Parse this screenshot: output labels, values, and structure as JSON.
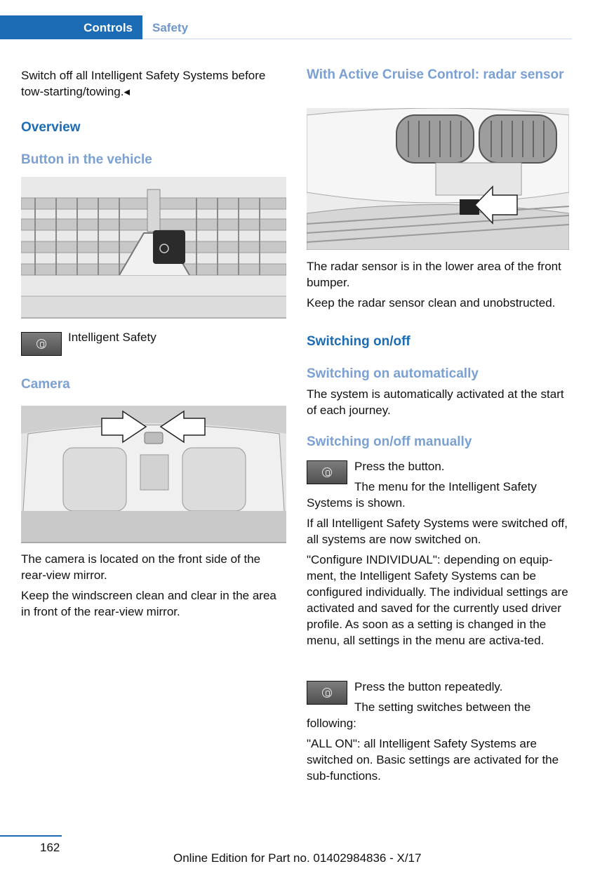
{
  "header": {
    "section": "Controls",
    "topic": "Safety"
  },
  "left": {
    "intro": "Switch off all Intelligent Safety Systems before tow-starting/towing.◂",
    "overview_heading": "Overview",
    "button_heading": "Button in the vehicle",
    "button_caption": "Intelligent Safety",
    "camera_heading": "Camera",
    "camera_p1": "The camera is located on the front side of the rear-view mirror.",
    "camera_p2": "Keep the windscreen clean and clear in the area in front of the rear-view mirror."
  },
  "right": {
    "radar_heading": "With Active Cruise Control: radar sensor",
    "radar_p1": "The radar sensor is in the lower area of the front bumper.",
    "radar_p2": "Keep the radar sensor clean and unobstructed.",
    "switch_heading": "Switching on/off",
    "auto_heading": "Switching on automatically",
    "auto_p": "The system is automatically activated at the start of each journey.",
    "manual_heading": "Switching on/off manually",
    "press_1": "Press the button.",
    "menu_shown": "The menu for the Intelligent Safety Systems is shown.",
    "if_all": "If all Intelligent Safety Systems were switched off, all systems are now switched on.",
    "configure": "\"Configure INDIVIDUAL\": depending on equip-ment, the Intelligent Safety Systems can be configured individually. The individual settings are activated and saved for the currently used driver profile. As soon as a setting is changed in the menu, all settings in the menu are activa-ted.",
    "press_2": "Press the button repeatedly.",
    "switches": "The setting switches between the following:",
    "all_on": "\"ALL ON\": all Intelligent Safety Systems are switched on. Basic settings are activated for the sub-functions."
  },
  "footer": {
    "page": "162",
    "edition": "Online Edition for Part no. 01402984836 - X/17"
  }
}
